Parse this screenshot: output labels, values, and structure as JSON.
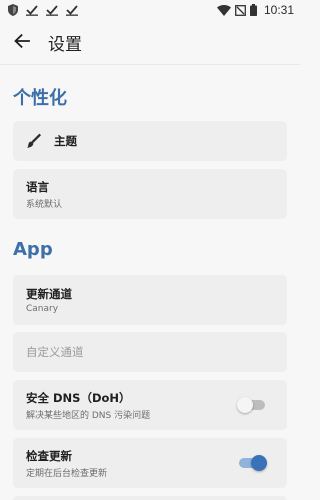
{
  "status_bar": {
    "time": "10:31",
    "icons": [
      "shield-icon",
      "check-icon",
      "check-icon",
      "check-icon",
      "wifi-icon",
      "no-sim-icon",
      "battery-icon"
    ]
  },
  "app_bar": {
    "back_icon": "arrow-left-icon",
    "title": "设置"
  },
  "sections": {
    "personalization": {
      "title": "个性化",
      "theme": {
        "icon": "paintbrush-icon",
        "label": "主题"
      },
      "language": {
        "label": "语言",
        "value": "系统默认"
      }
    },
    "app": {
      "title": "App",
      "update_channel": {
        "label": "更新通道",
        "value": "Canary"
      },
      "custom_channel": {
        "placeholder": "自定义通道"
      },
      "secure_dns": {
        "label": "安全 DNS（DoH）",
        "description": "解决某些地区的 DNS 污染问题",
        "enabled": false
      },
      "check_updates": {
        "label": "检查更新",
        "description": "定期在后台检查更新",
        "enabled": true
      }
    }
  },
  "colors": {
    "accent": "#3d6fa8",
    "toggle_on": "#3a72b8",
    "card_bg": "#eeeeee",
    "page_bg": "#f7f7f7"
  }
}
